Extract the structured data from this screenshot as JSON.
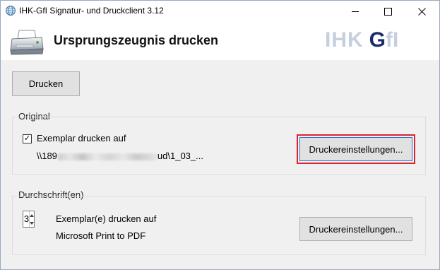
{
  "window": {
    "title": "IHK-GfI Signatur- und Druckclient 3.12",
    "controls": {
      "minimize": "minimize",
      "maximize": "maximize",
      "close": "close"
    }
  },
  "header": {
    "title": "Ursprungszeugnis drucken",
    "brand": {
      "part1": "IHK",
      "part2": "G",
      "part3": "fI"
    },
    "icon": "printer-icon"
  },
  "toolbar": {
    "print_label": "Drucken"
  },
  "original": {
    "group_label": "Original",
    "checkbox_label": "Exemplar drucken auf",
    "checkbox_checked": true,
    "path_start": "\\\\189",
    "path_end": "ud\\1_03_...",
    "settings_label": "Druckereinstellungen..."
  },
  "copies": {
    "group_label": "Durchschrift(en)",
    "count": "3",
    "label": "Exemplar(e) drucken auf",
    "printer": "Microsoft Print to PDF",
    "settings_label": "Druckereinstellungen..."
  },
  "colors": {
    "accent_focus": "#d9262c",
    "brand_dark": "#1a2c6b",
    "brand_light": "#c5cfdf"
  }
}
